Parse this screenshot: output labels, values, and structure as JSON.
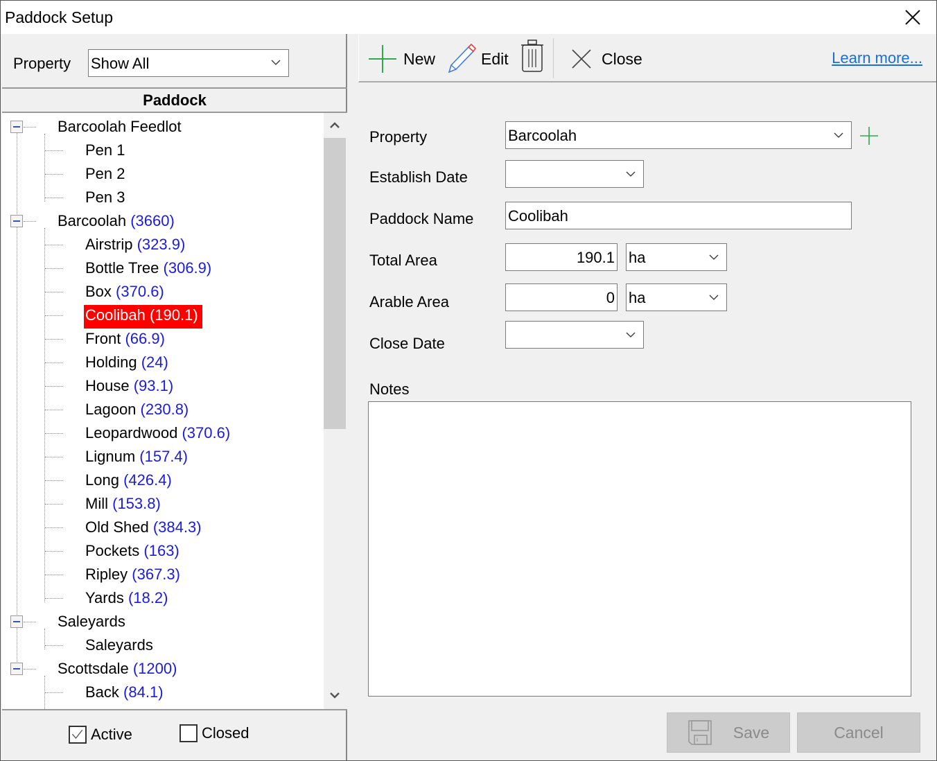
{
  "window": {
    "title": "Paddock Setup",
    "close_icon": "close-icon"
  },
  "left_panel": {
    "property_label": "Property",
    "property_filter": "Show All",
    "tree_header": "Paddock",
    "tree": [
      {
        "level": 0,
        "name": "Barcoolah Feedlot",
        "count": "",
        "expanded": true
      },
      {
        "level": 1,
        "name": "Pen 1",
        "count": ""
      },
      {
        "level": 1,
        "name": "Pen 2",
        "count": ""
      },
      {
        "level": 1,
        "name": "Pen 3",
        "count": ""
      },
      {
        "level": 0,
        "name": "Barcoolah",
        "count": "(3660)",
        "expanded": true
      },
      {
        "level": 1,
        "name": "Airstrip",
        "count": "(323.9)"
      },
      {
        "level": 1,
        "name": "Bottle Tree",
        "count": "(306.9)"
      },
      {
        "level": 1,
        "name": "Box",
        "count": "(370.6)"
      },
      {
        "level": 1,
        "name": "Coolibah",
        "count": "(190.1)",
        "selected": true
      },
      {
        "level": 1,
        "name": "Front",
        "count": "(66.9)"
      },
      {
        "level": 1,
        "name": "Holding",
        "count": "(24)"
      },
      {
        "level": 1,
        "name": "House",
        "count": "(93.1)"
      },
      {
        "level": 1,
        "name": "Lagoon",
        "count": "(230.8)"
      },
      {
        "level": 1,
        "name": "Leopardwood",
        "count": "(370.6)"
      },
      {
        "level": 1,
        "name": "Lignum",
        "count": "(157.4)"
      },
      {
        "level": 1,
        "name": "Long",
        "count": "(426.4)"
      },
      {
        "level": 1,
        "name": "Mill",
        "count": "(153.8)"
      },
      {
        "level": 1,
        "name": "Old Shed",
        "count": "(384.3)"
      },
      {
        "level": 1,
        "name": "Pockets",
        "count": "(163)"
      },
      {
        "level": 1,
        "name": "Ripley",
        "count": "(367.3)"
      },
      {
        "level": 1,
        "name": "Yards",
        "count": "(18.2)"
      },
      {
        "level": 0,
        "name": "Saleyards",
        "count": "",
        "expanded": true
      },
      {
        "level": 1,
        "name": "Saleyards",
        "count": ""
      },
      {
        "level": 0,
        "name": "Scottsdale",
        "count": "(1200)",
        "expanded": true
      },
      {
        "level": 1,
        "name": "Back",
        "count": "(84.1)"
      }
    ],
    "filters": {
      "active_label": "Active",
      "active_checked": true,
      "closed_label": "Closed",
      "closed_checked": false
    }
  },
  "toolbar": {
    "new_label": "New",
    "edit_label": "Edit",
    "delete_icon": "trash-icon",
    "close_label": "Close",
    "learn_more": "Learn more..."
  },
  "form": {
    "property_label": "Property",
    "property_value": "Barcoolah",
    "establish_date_label": "Establish Date",
    "establish_date_value": "",
    "paddock_name_label": "Paddock Name",
    "paddock_name_value": "Coolibah",
    "total_area_label": "Total Area",
    "total_area_value": "190.1",
    "total_area_unit": "ha",
    "arable_area_label": "Arable Area",
    "arable_area_value": "0",
    "arable_area_unit": "ha",
    "close_date_label": "Close Date",
    "close_date_value": "",
    "notes_label": "Notes",
    "notes_value": ""
  },
  "actions": {
    "save_label": "Save",
    "cancel_label": "Cancel"
  },
  "colors": {
    "selected_bg": "#ff0000",
    "count_text": "#1a1ae6",
    "accent_green": "#2ea84a",
    "link": "#1a6fd6"
  }
}
